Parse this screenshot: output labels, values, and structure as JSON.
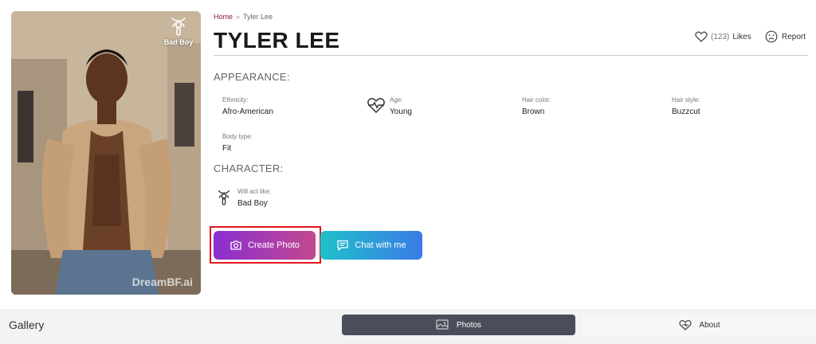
{
  "breadcrumb": {
    "home": "Home",
    "separator": "»",
    "current": "Tyler Lee"
  },
  "profile": {
    "name": "TYLER LEE",
    "badge": "Bad Boy",
    "watermark": "DreamBF.ai",
    "likes_count": "(123)",
    "likes_label": "Likes",
    "report_label": "Report"
  },
  "appearance": {
    "title": "APPEARANCE:",
    "ethnicity": {
      "label": "Ethnicity:",
      "value": "Afro-American"
    },
    "age": {
      "label": "Age:",
      "value": "Young"
    },
    "hair_color": {
      "label": "Hair color:",
      "value": "Brown"
    },
    "hair_style": {
      "label": "Hair style:",
      "value": "Buzzcut"
    },
    "body_type": {
      "label": "Body type:",
      "value": "Fit"
    }
  },
  "character": {
    "title": "CHARACTER:",
    "act_like": {
      "label": "Will act like:",
      "value": "Bad Boy"
    }
  },
  "actions": {
    "create_photo": "Create Photo",
    "chat": "Chat with me"
  },
  "gallery": {
    "title": "Gallery",
    "tab_photos": "Photos",
    "tab_about": "About"
  },
  "colors": {
    "accent": "#8a1b3d",
    "create_photo_start": "#8a2fd1",
    "create_photo_end": "#c2488f",
    "chat_start": "#1fc0c9",
    "chat_end": "#3a7be6",
    "highlight": "#e0161e",
    "tab_active": "#4a4e5a"
  },
  "icons": [
    "motorcycle-icon",
    "heart-icon",
    "sad-face-icon",
    "heartbeat-icon",
    "camera-icon",
    "chat-icon",
    "image-icon",
    "heart-hands-icon"
  ]
}
